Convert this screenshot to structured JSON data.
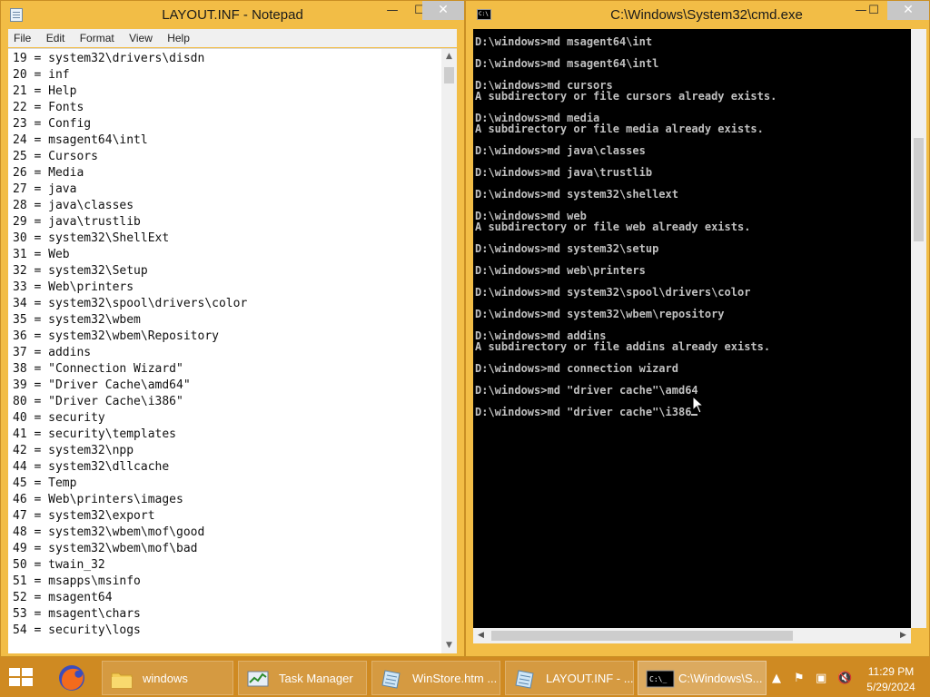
{
  "notepad": {
    "title": "LAYOUT.INF - Notepad",
    "menu": [
      "File",
      "Edit",
      "Format",
      "View",
      "Help"
    ],
    "lines": [
      "19 = system32\\drivers\\disdn",
      "20 = inf",
      "21 = Help",
      "22 = Fonts",
      "23 = Config",
      "24 = msagent64\\intl",
      "25 = Cursors",
      "26 = Media",
      "27 = java",
      "28 = java\\classes",
      "29 = java\\trustlib",
      "30 = system32\\ShellExt",
      "31 = Web",
      "32 = system32\\Setup",
      "33 = Web\\printers",
      "34 = system32\\spool\\drivers\\color",
      "35 = system32\\wbem",
      "36 = system32\\wbem\\Repository",
      "37 = addins",
      "38 = \"Connection Wizard\"",
      "39 = \"Driver Cache\\amd64\"",
      "80 = \"Driver Cache\\i386\"",
      "40 = security",
      "41 = security\\templates",
      "42 = system32\\npp",
      "44 = system32\\dllcache",
      "45 = Temp",
      "46 = Web\\printers\\images",
      "47 = system32\\export",
      "48 = system32\\wbem\\mof\\good",
      "49 = system32\\wbem\\mof\\bad",
      "50 = twain_32",
      "51 = msapps\\msinfo",
      "52 = msagent64",
      "53 = msagent\\chars",
      "54 = security\\logs"
    ]
  },
  "cmd": {
    "title": "C:\\Windows\\System32\\cmd.exe",
    "lines": [
      "D:\\windows>md msagent64\\int",
      "",
      "D:\\windows>md msagent64\\intl",
      "",
      "D:\\windows>md cursors",
      "A subdirectory or file cursors already exists.",
      "",
      "D:\\windows>md media",
      "A subdirectory or file media already exists.",
      "",
      "D:\\windows>md java\\classes",
      "",
      "D:\\windows>md java\\trustlib",
      "",
      "D:\\windows>md system32\\shellext",
      "",
      "D:\\windows>md web",
      "A subdirectory or file web already exists.",
      "",
      "D:\\windows>md system32\\setup",
      "",
      "D:\\windows>md web\\printers",
      "",
      "D:\\windows>md system32\\spool\\drivers\\color",
      "",
      "D:\\windows>md system32\\wbem\\repository",
      "",
      "D:\\windows>md addins",
      "A subdirectory or file addins already exists.",
      "",
      "D:\\windows>md connection wizard",
      "",
      "D:\\windows>md \"driver cache\"\\amd64",
      "",
      "D:\\windows>md \"driver cache\"\\i386"
    ]
  },
  "taskbar": {
    "items": [
      {
        "label": "windows",
        "icon": "folder-icon"
      },
      {
        "label": "Task Manager",
        "icon": "task-manager-icon"
      },
      {
        "label": "WinStore.htm ...",
        "icon": "notepad-icon"
      },
      {
        "label": "LAYOUT.INF - ...",
        "icon": "notepad-icon"
      },
      {
        "label": "C:\\Windows\\S...",
        "icon": "cmd-icon"
      }
    ],
    "clock": {
      "time": "11:29 PM",
      "date": "5/29/2024"
    }
  },
  "window_controls": {
    "minimize": "—",
    "maximize": "☐",
    "close": "✕"
  }
}
